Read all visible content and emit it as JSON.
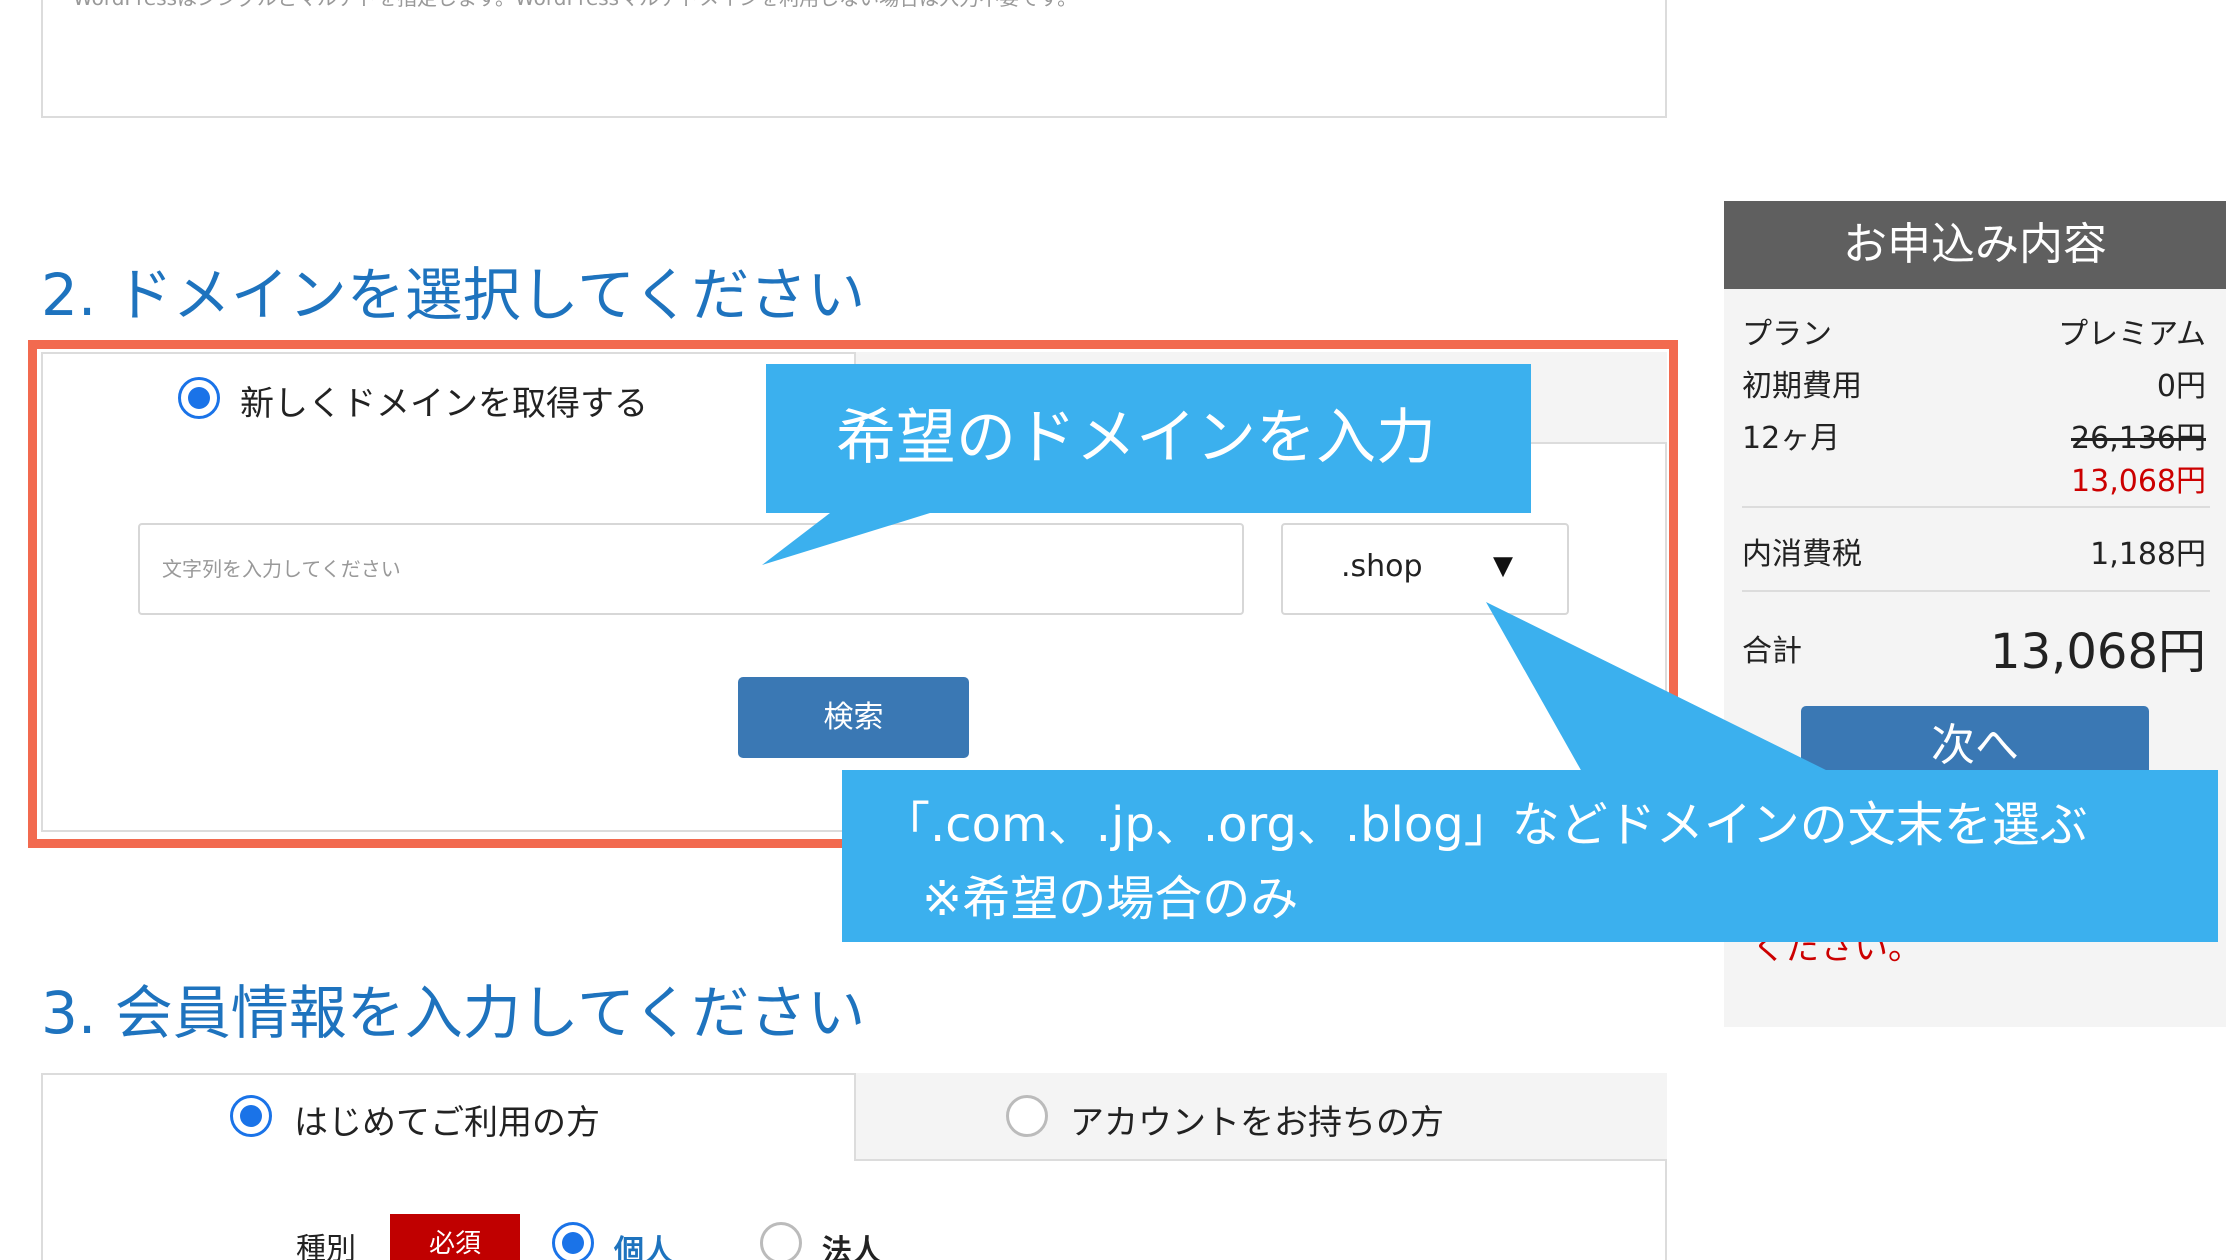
{
  "top_box": {
    "text": "WordPressはシングルとマルチドを指定します。WordPressマルチドメインを利用しない場合は入力不要です。"
  },
  "section2": {
    "title": "2. ドメインを選択してください",
    "radio_new_label": "新しくドメインを取得する",
    "input_placeholder": "文字列を入力してください",
    "tld_selected": ".shop",
    "tld_arrow": "▼",
    "search_label": "検索"
  },
  "callouts": {
    "domain": "希望のドメインを入力",
    "tld_line1": "「.com、.jp、.org、.blog」などドメインの文末を選ぶ",
    "tld_line2": "※希望の場合のみ"
  },
  "summary": {
    "header": "お申込み内容",
    "plan_label": "プラン",
    "plan_value": "プレミアム",
    "initial_label": "初期費用",
    "initial_value": "0円",
    "months_label": "12ヶ月",
    "months_old_price": "26,136円",
    "months_new_price": "13,068円",
    "tax_label": "内消費税",
    "tax_value": "1,188円",
    "total_label": "合計",
    "total_value": "13,068円",
    "next_label": "次へ",
    "note": "ください。"
  },
  "section3": {
    "title": "3. 会員情報を入力してください",
    "radio_first_label": "はじめてご利用の方",
    "radio_account_label": "アカウントをお持ちの方",
    "type_label": "種別",
    "required_badge": "必須",
    "personal_label": "個人",
    "corporate_label": "法人"
  },
  "colors": {
    "accent_blue": "#1e73be",
    "button_blue": "#3a78b4",
    "callout_blue": "#3bb0ee",
    "highlight_frame": "#f26a4f",
    "required_red": "#c00000"
  }
}
